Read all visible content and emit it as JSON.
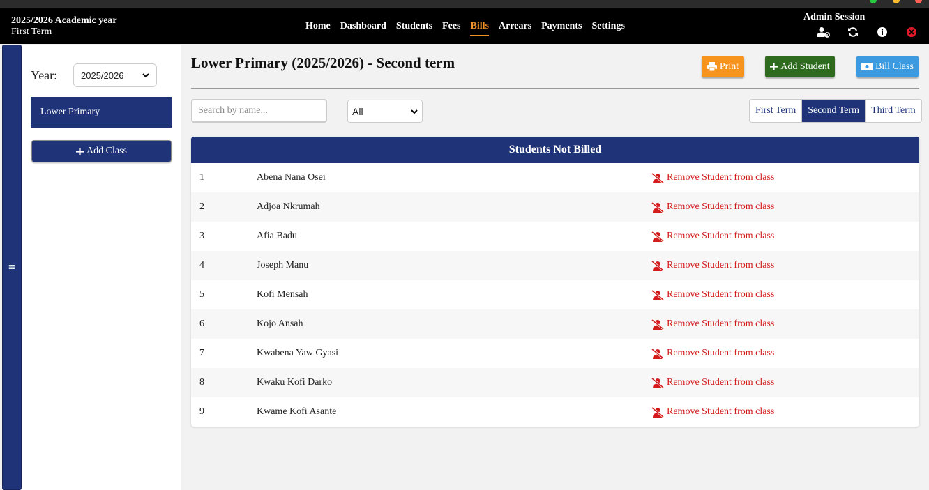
{
  "window": {
    "dots": [
      "#27c93f",
      "#ffbd2e",
      "#ff5f56"
    ]
  },
  "header": {
    "academic_year": "2025/2026 Academic year",
    "term": "First Term",
    "nav": [
      {
        "label": "Home",
        "active": false
      },
      {
        "label": "Dashboard",
        "active": false
      },
      {
        "label": "Students",
        "active": false
      },
      {
        "label": "Fees",
        "active": false
      },
      {
        "label": "Bills",
        "active": true
      },
      {
        "label": "Arrears",
        "active": false
      },
      {
        "label": "Payments",
        "active": false
      },
      {
        "label": "Settings",
        "active": false
      }
    ],
    "session_label": "Admin Session",
    "session_icons": [
      "user-settings-icon",
      "refresh-icon",
      "info-icon",
      "close-icon"
    ]
  },
  "sidebar": {
    "toggle_icon": "≡",
    "year_label": "Year:",
    "year_value": "2025/2026",
    "classes": [
      "Lower Primary"
    ],
    "add_class_label": "Add Class"
  },
  "main": {
    "title": "Lower Primary (2025/2026) - Second term",
    "print_label": "Print",
    "add_student_label": "Add Student",
    "bill_class_label": "Bill Class",
    "search_placeholder": "Search by name...",
    "filter_value": "All",
    "terms": [
      {
        "label": "First Term",
        "selected": false
      },
      {
        "label": "Second Term",
        "selected": true
      },
      {
        "label": "Third Term",
        "selected": false
      }
    ],
    "table_title": "Students Not Billed",
    "remove_label": "Remove Student from class",
    "students": [
      {
        "num": "1",
        "name": "Abena Nana Osei"
      },
      {
        "num": "2",
        "name": "Adjoa Nkrumah"
      },
      {
        "num": "3",
        "name": "Afia Badu"
      },
      {
        "num": "4",
        "name": "Joseph Manu"
      },
      {
        "num": "5",
        "name": "Kofi Mensah"
      },
      {
        "num": "6",
        "name": "Kojo Ansah"
      },
      {
        "num": "7",
        "name": "Kwabena Yaw Gyasi"
      },
      {
        "num": "8",
        "name": "Kwaku Kofi Darko"
      },
      {
        "num": "9",
        "name": "Kwame Kofi Asante"
      }
    ]
  },
  "colors": {
    "primary": "#1f3478",
    "accent": "#f0932b",
    "danger": "#d21c1c",
    "print": "#f7941d",
    "add": "#2e6b1e",
    "bill": "#3c9be0"
  }
}
